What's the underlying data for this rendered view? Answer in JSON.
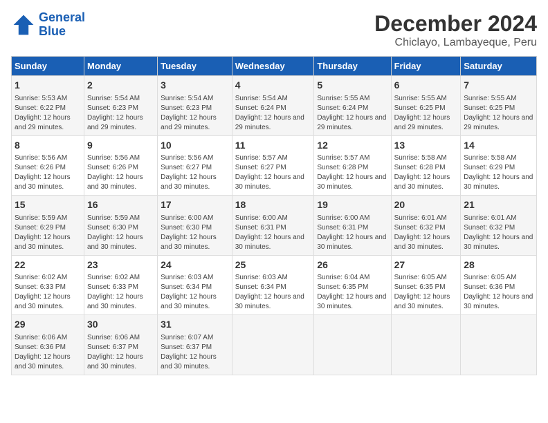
{
  "logo": {
    "line1": "General",
    "line2": "Blue"
  },
  "title": "December 2024",
  "subtitle": "Chiclayo, Lambayeque, Peru",
  "days_of_week": [
    "Sunday",
    "Monday",
    "Tuesday",
    "Wednesday",
    "Thursday",
    "Friday",
    "Saturday"
  ],
  "weeks": [
    [
      {
        "day": "1",
        "info": "Sunrise: 5:53 AM\nSunset: 6:22 PM\nDaylight: 12 hours and 29 minutes."
      },
      {
        "day": "2",
        "info": "Sunrise: 5:54 AM\nSunset: 6:23 PM\nDaylight: 12 hours and 29 minutes."
      },
      {
        "day": "3",
        "info": "Sunrise: 5:54 AM\nSunset: 6:23 PM\nDaylight: 12 hours and 29 minutes."
      },
      {
        "day": "4",
        "info": "Sunrise: 5:54 AM\nSunset: 6:24 PM\nDaylight: 12 hours and 29 minutes."
      },
      {
        "day": "5",
        "info": "Sunrise: 5:55 AM\nSunset: 6:24 PM\nDaylight: 12 hours and 29 minutes."
      },
      {
        "day": "6",
        "info": "Sunrise: 5:55 AM\nSunset: 6:25 PM\nDaylight: 12 hours and 29 minutes."
      },
      {
        "day": "7",
        "info": "Sunrise: 5:55 AM\nSunset: 6:25 PM\nDaylight: 12 hours and 29 minutes."
      }
    ],
    [
      {
        "day": "8",
        "info": "Sunrise: 5:56 AM\nSunset: 6:26 PM\nDaylight: 12 hours and 30 minutes."
      },
      {
        "day": "9",
        "info": "Sunrise: 5:56 AM\nSunset: 6:26 PM\nDaylight: 12 hours and 30 minutes."
      },
      {
        "day": "10",
        "info": "Sunrise: 5:56 AM\nSunset: 6:27 PM\nDaylight: 12 hours and 30 minutes."
      },
      {
        "day": "11",
        "info": "Sunrise: 5:57 AM\nSunset: 6:27 PM\nDaylight: 12 hours and 30 minutes."
      },
      {
        "day": "12",
        "info": "Sunrise: 5:57 AM\nSunset: 6:28 PM\nDaylight: 12 hours and 30 minutes."
      },
      {
        "day": "13",
        "info": "Sunrise: 5:58 AM\nSunset: 6:28 PM\nDaylight: 12 hours and 30 minutes."
      },
      {
        "day": "14",
        "info": "Sunrise: 5:58 AM\nSunset: 6:29 PM\nDaylight: 12 hours and 30 minutes."
      }
    ],
    [
      {
        "day": "15",
        "info": "Sunrise: 5:59 AM\nSunset: 6:29 PM\nDaylight: 12 hours and 30 minutes."
      },
      {
        "day": "16",
        "info": "Sunrise: 5:59 AM\nSunset: 6:30 PM\nDaylight: 12 hours and 30 minutes."
      },
      {
        "day": "17",
        "info": "Sunrise: 6:00 AM\nSunset: 6:30 PM\nDaylight: 12 hours and 30 minutes."
      },
      {
        "day": "18",
        "info": "Sunrise: 6:00 AM\nSunset: 6:31 PM\nDaylight: 12 hours and 30 minutes."
      },
      {
        "day": "19",
        "info": "Sunrise: 6:00 AM\nSunset: 6:31 PM\nDaylight: 12 hours and 30 minutes."
      },
      {
        "day": "20",
        "info": "Sunrise: 6:01 AM\nSunset: 6:32 PM\nDaylight: 12 hours and 30 minutes."
      },
      {
        "day": "21",
        "info": "Sunrise: 6:01 AM\nSunset: 6:32 PM\nDaylight: 12 hours and 30 minutes."
      }
    ],
    [
      {
        "day": "22",
        "info": "Sunrise: 6:02 AM\nSunset: 6:33 PM\nDaylight: 12 hours and 30 minutes."
      },
      {
        "day": "23",
        "info": "Sunrise: 6:02 AM\nSunset: 6:33 PM\nDaylight: 12 hours and 30 minutes."
      },
      {
        "day": "24",
        "info": "Sunrise: 6:03 AM\nSunset: 6:34 PM\nDaylight: 12 hours and 30 minutes."
      },
      {
        "day": "25",
        "info": "Sunrise: 6:03 AM\nSunset: 6:34 PM\nDaylight: 12 hours and 30 minutes."
      },
      {
        "day": "26",
        "info": "Sunrise: 6:04 AM\nSunset: 6:35 PM\nDaylight: 12 hours and 30 minutes."
      },
      {
        "day": "27",
        "info": "Sunrise: 6:05 AM\nSunset: 6:35 PM\nDaylight: 12 hours and 30 minutes."
      },
      {
        "day": "28",
        "info": "Sunrise: 6:05 AM\nSunset: 6:36 PM\nDaylight: 12 hours and 30 minutes."
      }
    ],
    [
      {
        "day": "29",
        "info": "Sunrise: 6:06 AM\nSunset: 6:36 PM\nDaylight: 12 hours and 30 minutes."
      },
      {
        "day": "30",
        "info": "Sunrise: 6:06 AM\nSunset: 6:37 PM\nDaylight: 12 hours and 30 minutes."
      },
      {
        "day": "31",
        "info": "Sunrise: 6:07 AM\nSunset: 6:37 PM\nDaylight: 12 hours and 30 minutes."
      },
      {
        "day": "",
        "info": ""
      },
      {
        "day": "",
        "info": ""
      },
      {
        "day": "",
        "info": ""
      },
      {
        "day": "",
        "info": ""
      }
    ]
  ]
}
